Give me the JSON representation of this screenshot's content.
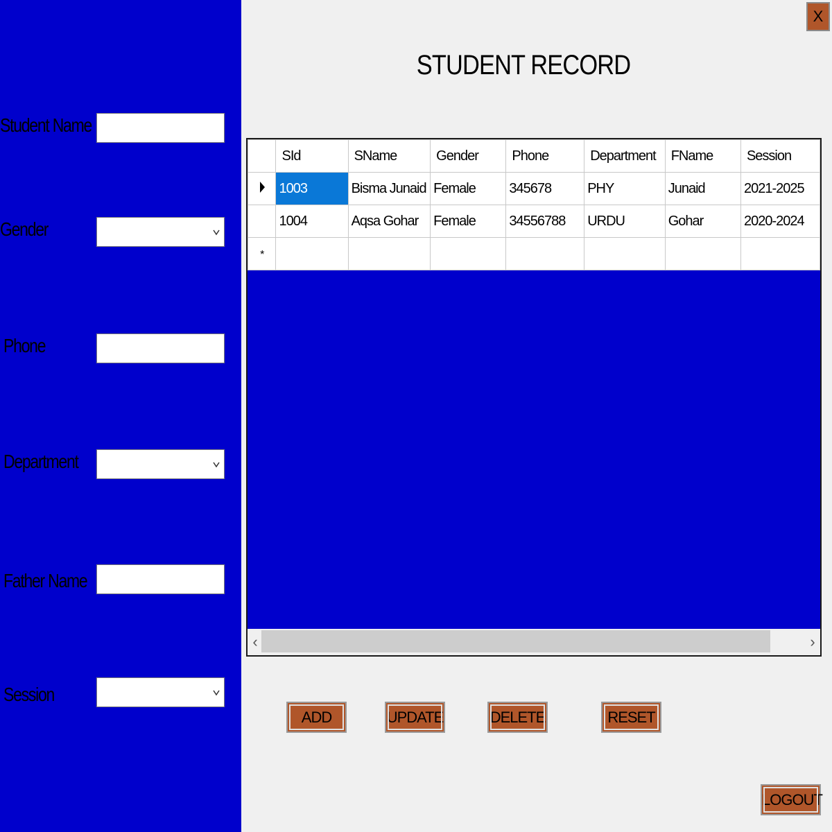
{
  "window": {
    "close_label": "X",
    "title": "STUDENT RECORD"
  },
  "form": {
    "student_name_label": "Student Name",
    "student_name_value": "",
    "gender_label": "Gender",
    "gender_value": "",
    "phone_label": "Phone",
    "phone_value": "",
    "department_label": "Department",
    "department_value": "",
    "father_name_label": "Father Name",
    "father_name_value": "",
    "session_label": "Session",
    "session_value": ""
  },
  "grid": {
    "columns": [
      "SId",
      "SName",
      "Gender",
      "Phone",
      "Department",
      "FName",
      "Session"
    ],
    "rows": [
      [
        "1003",
        "Bisma Junaid",
        "Female",
        "345678",
        "PHY",
        "Junaid",
        "2021-2025"
      ],
      [
        "1004",
        "Aqsa Gohar",
        "Female",
        "34556788",
        "URDU",
        "Gohar",
        "2020-2024"
      ]
    ],
    "new_row_marker": "*"
  },
  "buttons": {
    "add": "ADD",
    "update": "UPDATE",
    "delete": "DELETE",
    "reset": "RESET",
    "logout": "LOGOUT"
  },
  "colors": {
    "panel_blue": "#0000cc",
    "button_brown": "#b0562a",
    "selection_blue": "#0a78d7"
  }
}
